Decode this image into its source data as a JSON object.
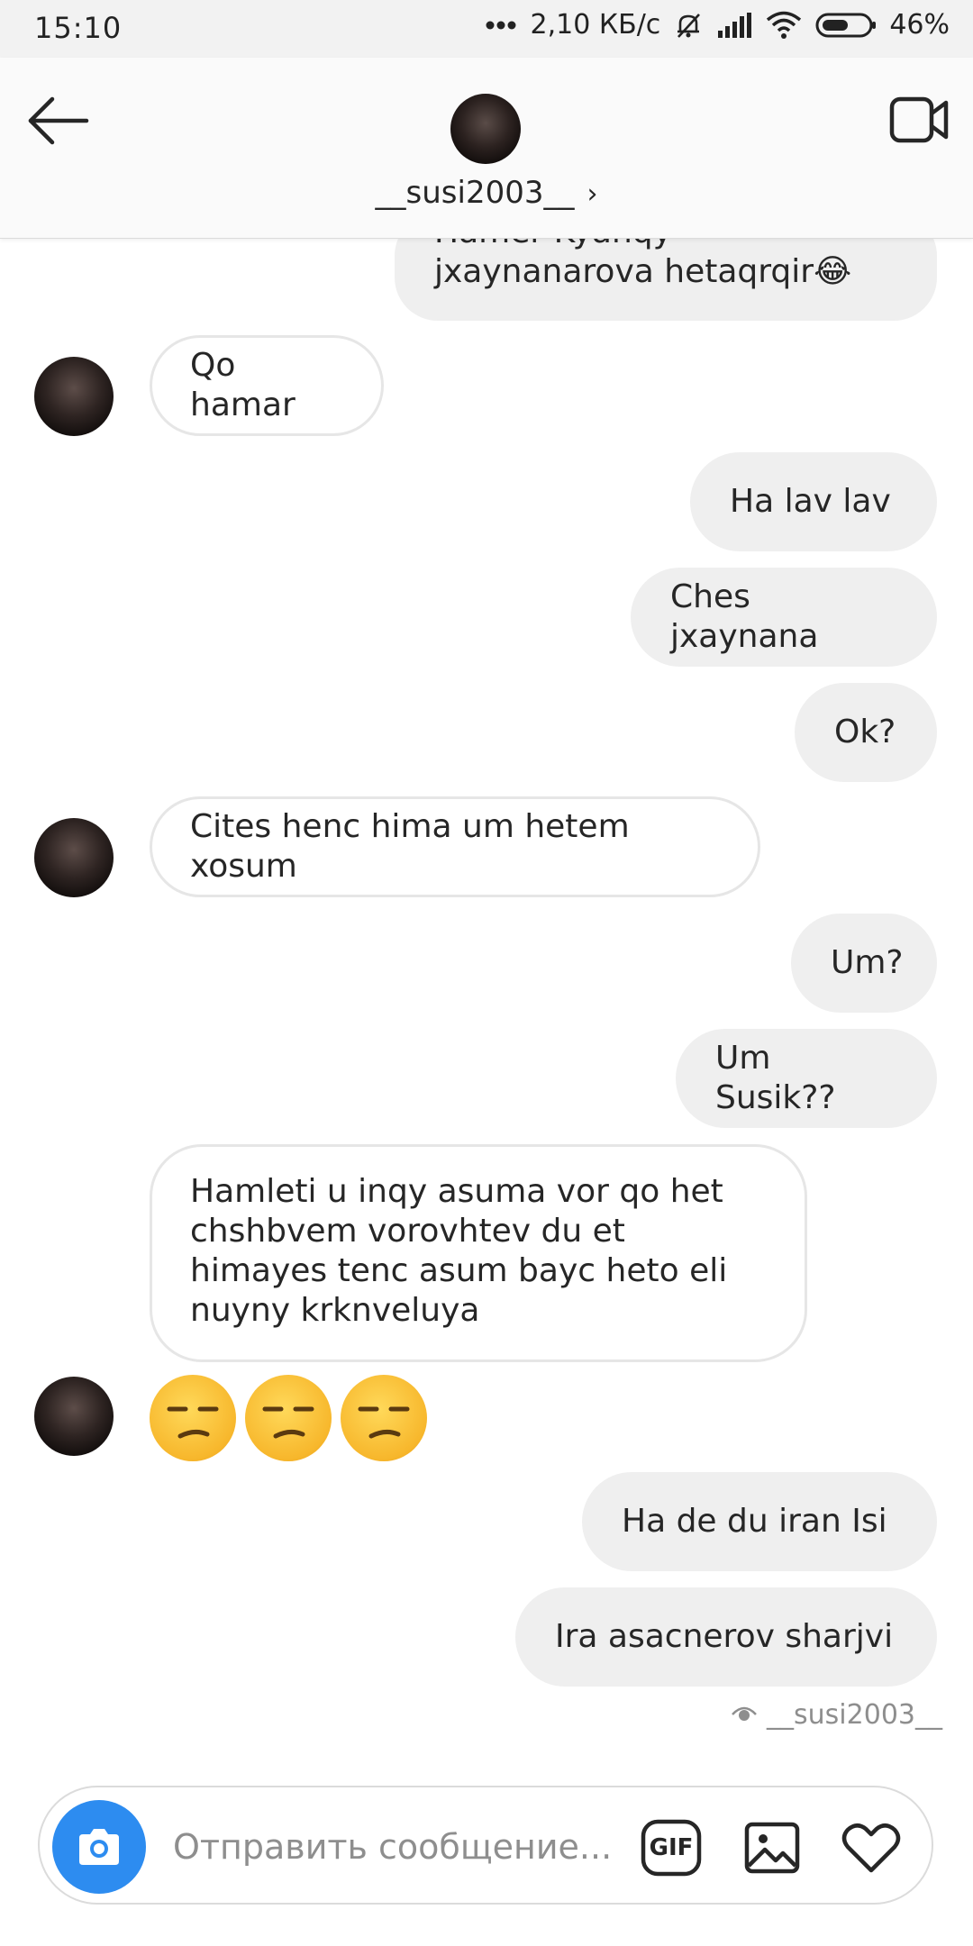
{
  "status_bar": {
    "time": "15:10",
    "network_speed": "2,10 КБ/с",
    "battery": "46%"
  },
  "header": {
    "username": "__susi2003__",
    "chevron": "›"
  },
  "messages": [
    {
      "id": "m0",
      "side": "out",
      "text": "Hamer Kyanqy jxaynanarova hetaqrqir😂"
    },
    {
      "id": "m1",
      "side": "in",
      "text": "Qo hamar"
    },
    {
      "id": "m2",
      "side": "out",
      "text": "Ha lav lav"
    },
    {
      "id": "m3",
      "side": "out",
      "text": "Ches jxaynana"
    },
    {
      "id": "m4",
      "side": "out",
      "text": "Ok?"
    },
    {
      "id": "m5",
      "side": "in",
      "text": "Cites henc hima um hetem xosum"
    },
    {
      "id": "m6",
      "side": "out",
      "text": "Um?"
    },
    {
      "id": "m7",
      "side": "out",
      "text": "Um Susik??"
    },
    {
      "id": "m8",
      "side": "in",
      "text": "Hamleti u inqy asuma vor qo het chshbvem vorovhtev du et himayes tenc asum bayc heto eli nuyny krknveluya"
    },
    {
      "id": "m9",
      "side": "in",
      "text": "😒😒😒"
    },
    {
      "id": "m10",
      "side": "out",
      "text": "Ha de du iran Isi"
    },
    {
      "id": "m11",
      "side": "out",
      "text": "Ira asacnerov sharjvi"
    }
  ],
  "seen_by": "__susi2003__",
  "composer": {
    "placeholder": "Отправить сообщение...",
    "gif_label": "GIF"
  },
  "colors": {
    "camera_button": "#2d8cf0",
    "outgoing_bubble": "#efefef",
    "incoming_border": "#e6e6e6"
  }
}
